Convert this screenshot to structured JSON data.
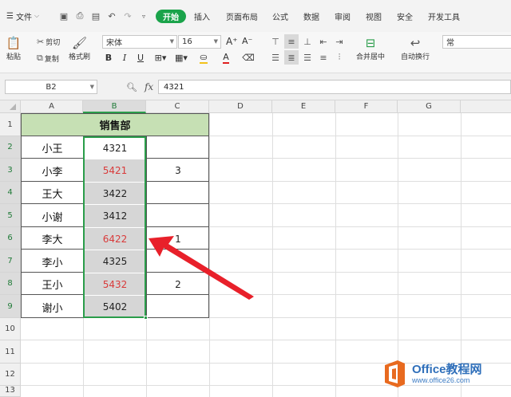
{
  "menu": {
    "file_label": "文件",
    "tabs": [
      "开始",
      "插入",
      "页面布局",
      "公式",
      "数据",
      "审阅",
      "视图",
      "安全",
      "开发工具"
    ]
  },
  "ribbon": {
    "paste": "粘贴",
    "cut": "剪切",
    "copy": "复制",
    "format_painter": "格式刷",
    "font_name": "宋体",
    "font_size": "16",
    "bold": "B",
    "italic": "I",
    "underline": "U",
    "merge_center": "合并居中",
    "wrap_text": "自动换行",
    "number_format_partial": "常"
  },
  "formula_bar": {
    "name_box": "B2",
    "fx": "fx",
    "content": "4321"
  },
  "grid": {
    "columns": [
      "A",
      "B",
      "C",
      "D",
      "E",
      "F",
      "G"
    ],
    "rows": [
      "1",
      "2",
      "3",
      "4",
      "5",
      "6",
      "7",
      "8",
      "9",
      "10",
      "11",
      "12",
      "13"
    ],
    "title": "销售部",
    "data_rows": [
      {
        "name": "小王",
        "value": "4321",
        "extra": ""
      },
      {
        "name": "小李",
        "value": "5421",
        "extra": "3"
      },
      {
        "name": "王大",
        "value": "3422",
        "extra": ""
      },
      {
        "name": "小谢",
        "value": "3412",
        "extra": ""
      },
      {
        "name": "李大",
        "value": "6422",
        "extra": "1"
      },
      {
        "name": "李小",
        "value": "4325",
        "extra": ""
      },
      {
        "name": "王小",
        "value": "5432",
        "extra": "2"
      },
      {
        "name": "谢小",
        "value": "5402",
        "extra": ""
      }
    ]
  },
  "colors": {
    "accent": "#1aa34a",
    "header_fill": "#c6e0b4",
    "highlight_text": "#d93a3a",
    "arrow": "#e8202a"
  },
  "watermark": {
    "main": "Office教程网",
    "sub": "www.office26.com"
  }
}
